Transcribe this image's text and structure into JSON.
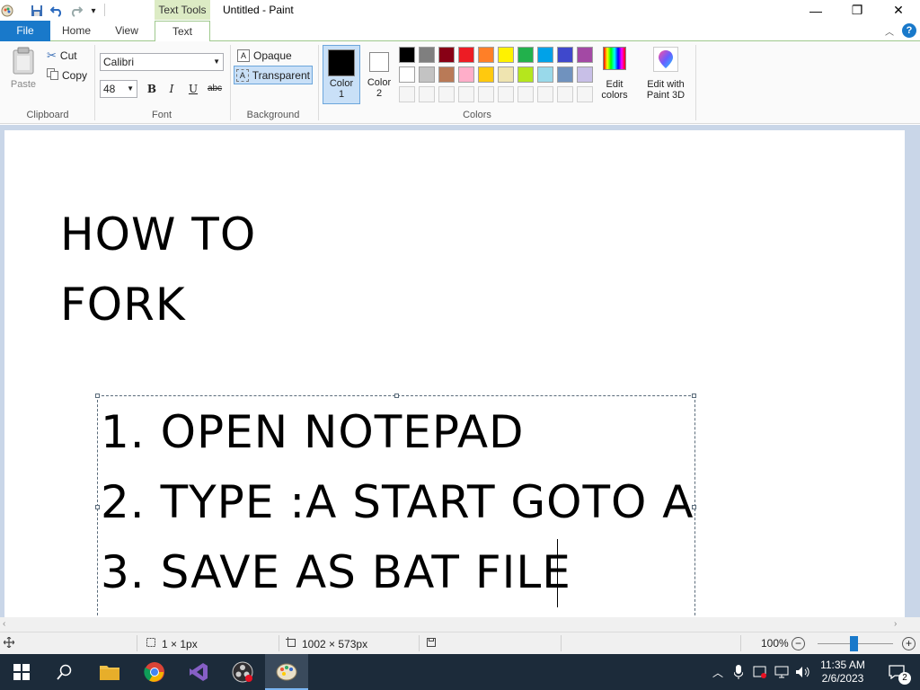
{
  "window": {
    "title": "Untitled - Paint",
    "context_tab": "Text Tools",
    "minimize": "—",
    "restore": "❐",
    "close": "✕"
  },
  "tabs": {
    "file": "File",
    "home": "Home",
    "view": "View",
    "text": "Text"
  },
  "ribbon": {
    "clipboard": {
      "label": "Clipboard",
      "paste": "Paste",
      "cut": "Cut",
      "copy": "Copy"
    },
    "font": {
      "label": "Font",
      "family": "Calibri",
      "size": "48",
      "bold": "B",
      "italic": "I",
      "underline": "U",
      "strikethrough": "abc"
    },
    "background": {
      "label": "Background",
      "opaque": "Opaque",
      "transparent": "Transparent"
    },
    "colors": {
      "label": "Colors",
      "color1": "Color 1",
      "color2": "Color 2",
      "edit_colors": "Edit colors",
      "edit_paint3d": "Edit with Paint 3D",
      "color1_value": "#000000",
      "color2_value": "#ffffff",
      "palette_row1": [
        "#000000",
        "#7f7f7f",
        "#880015",
        "#ed1c24",
        "#ff7f27",
        "#fff200",
        "#22b14c",
        "#00a2e8",
        "#3f48cc",
        "#a349a4"
      ],
      "palette_row2": [
        "#ffffff",
        "#c3c3c3",
        "#b97a57",
        "#ffaec9",
        "#ffc90e",
        "#efe4b0",
        "#b5e61d",
        "#99d9ea",
        "#7092be",
        "#c8bfe7"
      ],
      "palette_row3": [
        "#f5f5f5",
        "#f5f5f5",
        "#f5f5f5",
        "#f5f5f5",
        "#f5f5f5",
        "#f5f5f5",
        "#f5f5f5",
        "#f5f5f5",
        "#f5f5f5",
        "#f5f5f5"
      ]
    }
  },
  "canvas": {
    "heading_line1": "HOW TO",
    "heading_line2": "FORK",
    "lines": [
      "1. OPEN NOTEPAD",
      "2. TYPE :A START GOTO A",
      "3. SAVE AS BAT FILE"
    ]
  },
  "status": {
    "selection_size": "1 × 1px",
    "canvas_size": "1002 × 573px",
    "zoom": "100%",
    "zoom_level": 1.0
  },
  "taskbar": {
    "time": "11:35 AM",
    "date": "2/6/2023",
    "notifications": "2"
  }
}
